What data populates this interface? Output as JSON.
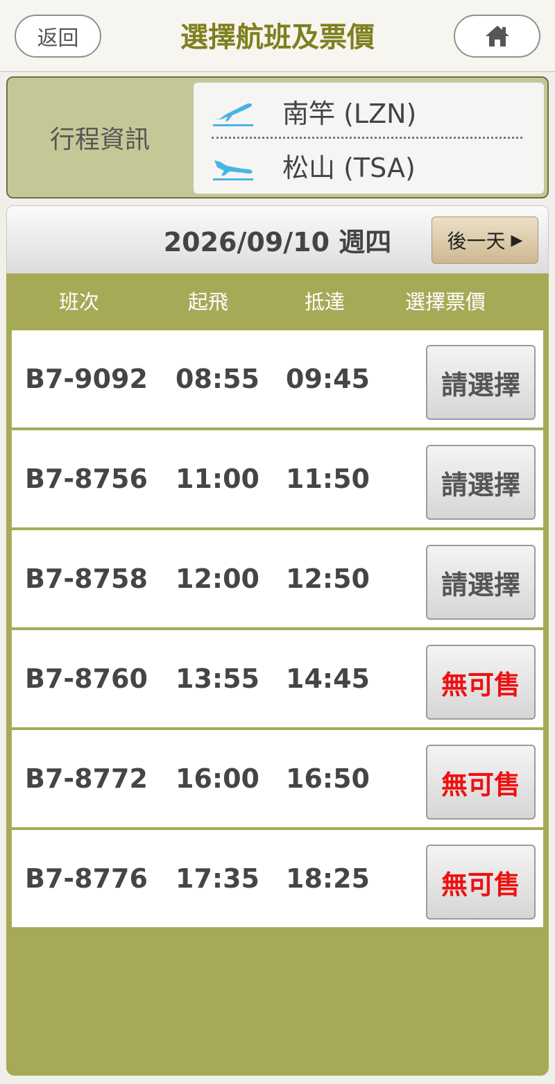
{
  "header": {
    "back_label": "返回",
    "title": "選擇航班及票價",
    "home_icon": "home-icon"
  },
  "trip": {
    "label": "行程資訊",
    "origin": "南竿 (LZN)",
    "destination": "松山 (TSA)"
  },
  "date_bar": {
    "date": "2026/09/10 週四",
    "next_label": "後一天"
  },
  "columns": {
    "flight": "班次",
    "departure": "起飛",
    "arrival": "抵達",
    "price": "選擇票價"
  },
  "flights": [
    {
      "flight": "B7-9092",
      "dep": "08:55",
      "arr": "09:45",
      "action": "請選擇"
    },
    {
      "flight": "B7-8756",
      "dep": "11:00",
      "arr": "11:50",
      "action": "請選擇"
    },
    {
      "flight": "B7-8758",
      "dep": "12:00",
      "arr": "12:50",
      "action": "請選擇"
    },
    {
      "flight": "B7-8760",
      "dep": "13:55",
      "arr": "14:45",
      "action": "無可售"
    },
    {
      "flight": "B7-8772",
      "dep": "16:00",
      "arr": "16:50",
      "action": "無可售"
    },
    {
      "flight": "B7-8776",
      "dep": "17:35",
      "arr": "18:25",
      "action": "無可售"
    }
  ],
  "colors": {
    "title": "#7f7f1e",
    "list_bg": "#a6aa57",
    "soldout": "#ee1111",
    "plane": "#4ab3e6"
  }
}
